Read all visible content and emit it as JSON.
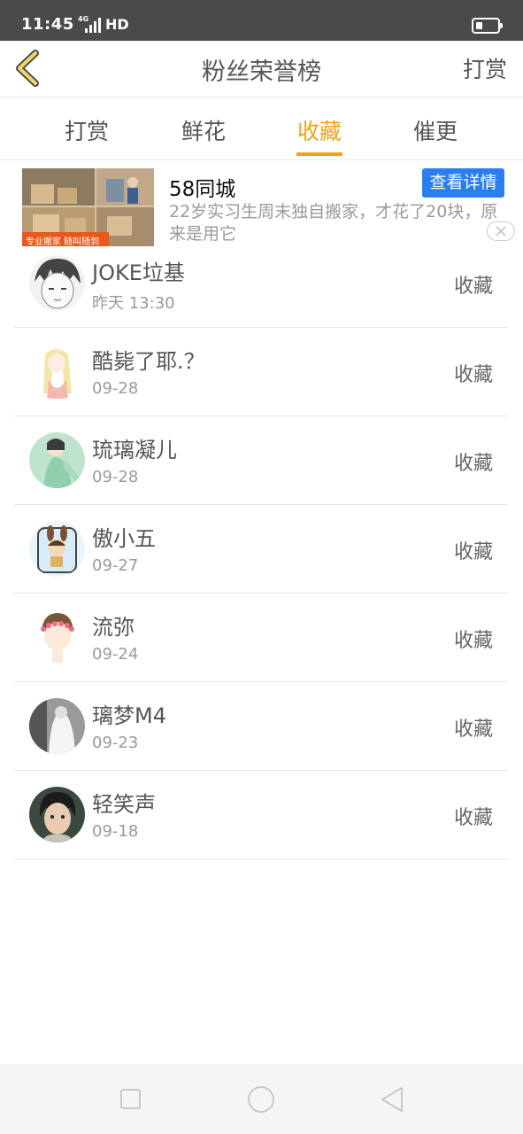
{
  "status_bar": {
    "time": "11:45",
    "network_label": "4G",
    "hd_label": "HD",
    "signal_bars": 4,
    "battery_level": 0.3
  },
  "header": {
    "back_icon": "chevron-left-icon",
    "title": "粉丝荣誉榜",
    "right_action": "打赏"
  },
  "tabs": {
    "items": [
      {
        "label": "打赏"
      },
      {
        "label": "鲜花"
      },
      {
        "label": "收藏"
      },
      {
        "label": "催更"
      }
    ],
    "active_index": 2,
    "active_color": "#f0a21c"
  },
  "ad": {
    "advertiser": "58同城",
    "description": "22岁实习生周末独自搬家，才花了20块，原来是用它",
    "cta": "查看详情",
    "cta_color": "#2a7ef0",
    "thumb_caption": "专业搬家 随叫随到"
  },
  "list": {
    "items": [
      {
        "name": "JOKE垃基",
        "date": "昨天 13:30",
        "action": "收藏"
      },
      {
        "name": "酷毙了耶.？",
        "date": "09-28",
        "action": "收藏"
      },
      {
        "name": "琉璃凝儿",
        "date": "09-28",
        "action": "收藏"
      },
      {
        "name": "傲小五",
        "date": "09-27",
        "action": "收藏"
      },
      {
        "name": "流弥",
        "date": "09-24",
        "action": "收藏"
      },
      {
        "name": "璃梦M4",
        "date": "09-23",
        "action": "收藏"
      },
      {
        "name": "轻笑声",
        "date": "09-18",
        "action": "收藏"
      }
    ]
  },
  "nav_bar": {
    "buttons": [
      "square-icon",
      "circle-icon",
      "triangle-back-icon"
    ]
  }
}
